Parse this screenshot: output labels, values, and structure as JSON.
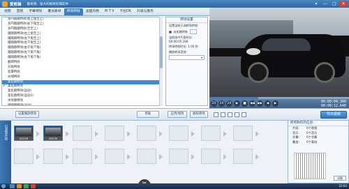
{
  "window": {
    "app_name": "爱剪辑",
    "slogan": "最易用、强大的视频剪辑软件",
    "controls": [
      "▾",
      "—",
      "□",
      "✕"
    ]
  },
  "tabs": [
    {
      "label": "视频",
      "active": false
    },
    {
      "label": "音频",
      "active": false
    },
    {
      "label": "字幕特效",
      "active": false
    },
    {
      "label": "叠加素材",
      "active": false
    },
    {
      "label": "转场特效",
      "active": true
    },
    {
      "label": "画面风格",
      "active": false
    },
    {
      "label": "M T V",
      "active": false
    },
    {
      "label": "卡拉OK",
      "active": false
    },
    {
      "label": "升级与服务",
      "active": false
    }
  ],
  "effects": [
    "多円踏踏特效(右上角至上)",
    "多円踏踏特效(右下角至上)",
    "多円踏踏特效(至至上)",
    "踏踏踏特效(右上角至上)",
    "踏踏踏特效(右下角至上)",
    "踏踏踏特效(右下角至上)",
    "踏踏踏特效(由于角下角)",
    "踏踏踏特效(右下角下角)",
    "踏踏踏特效(右下角下角)",
    "翻转特效",
    "对角特效",
    "遮罩特效",
    "光线特效",
    "柔化踏特效",
    "柔化踏特效",
    "柔化踏特效(运动)",
    "柔化踏特效(运动2)",
    "水纹踏特效",
    "踏踏踏特效(运动)",
    "踏踏踏特效(运动)",
    "水纹踏特效"
  ],
  "selected_effect_index": 13,
  "checked_effect_index": 14,
  "settings": {
    "header": "转场设置",
    "line1": "设置当前已选转场特效:",
    "radio_label": "淡化踏特效",
    "line2": "当前选中片段时长: 00:00:05.268",
    "duration_label": "转场特效时长:",
    "duration_value": "1.00",
    "duration_unit": "秒",
    "sound_label": "播放转场音效:"
  },
  "left_buttons": {
    "apply_all": "设置播放特效",
    "help": "帮助",
    "apply_modify": "应用/修改",
    "delete": "删除转场"
  },
  "preview": {
    "time_current": "00:00:04.360",
    "time_total": "00:00:12.640",
    "progress_fraction": 0.35,
    "controls": [
      "2X",
      "1X",
      "2X",
      "▶",
      "■",
      "◀◀",
      "▶▶",
      "◀",
      "▶"
    ]
  },
  "export_label": "导出视频",
  "timeline": {
    "side_label": "已添加片段",
    "clips": [
      {
        "caption": "00139"
      },
      {
        "caption": "00139"
      }
    ]
  },
  "info": {
    "title": "所有制作的信息:",
    "items": [
      {
        "k": "片段:",
        "v": "0个视频"
      },
      {
        "k": "音乐:",
        "v": "0个音乐"
      },
      {
        "k": "字幕:",
        "v": "0个字幕"
      },
      {
        "k": "叠加:",
        "v": "0个素材"
      }
    ],
    "ok": "详细"
  },
  "taskbar": {
    "clock": "22:02"
  }
}
